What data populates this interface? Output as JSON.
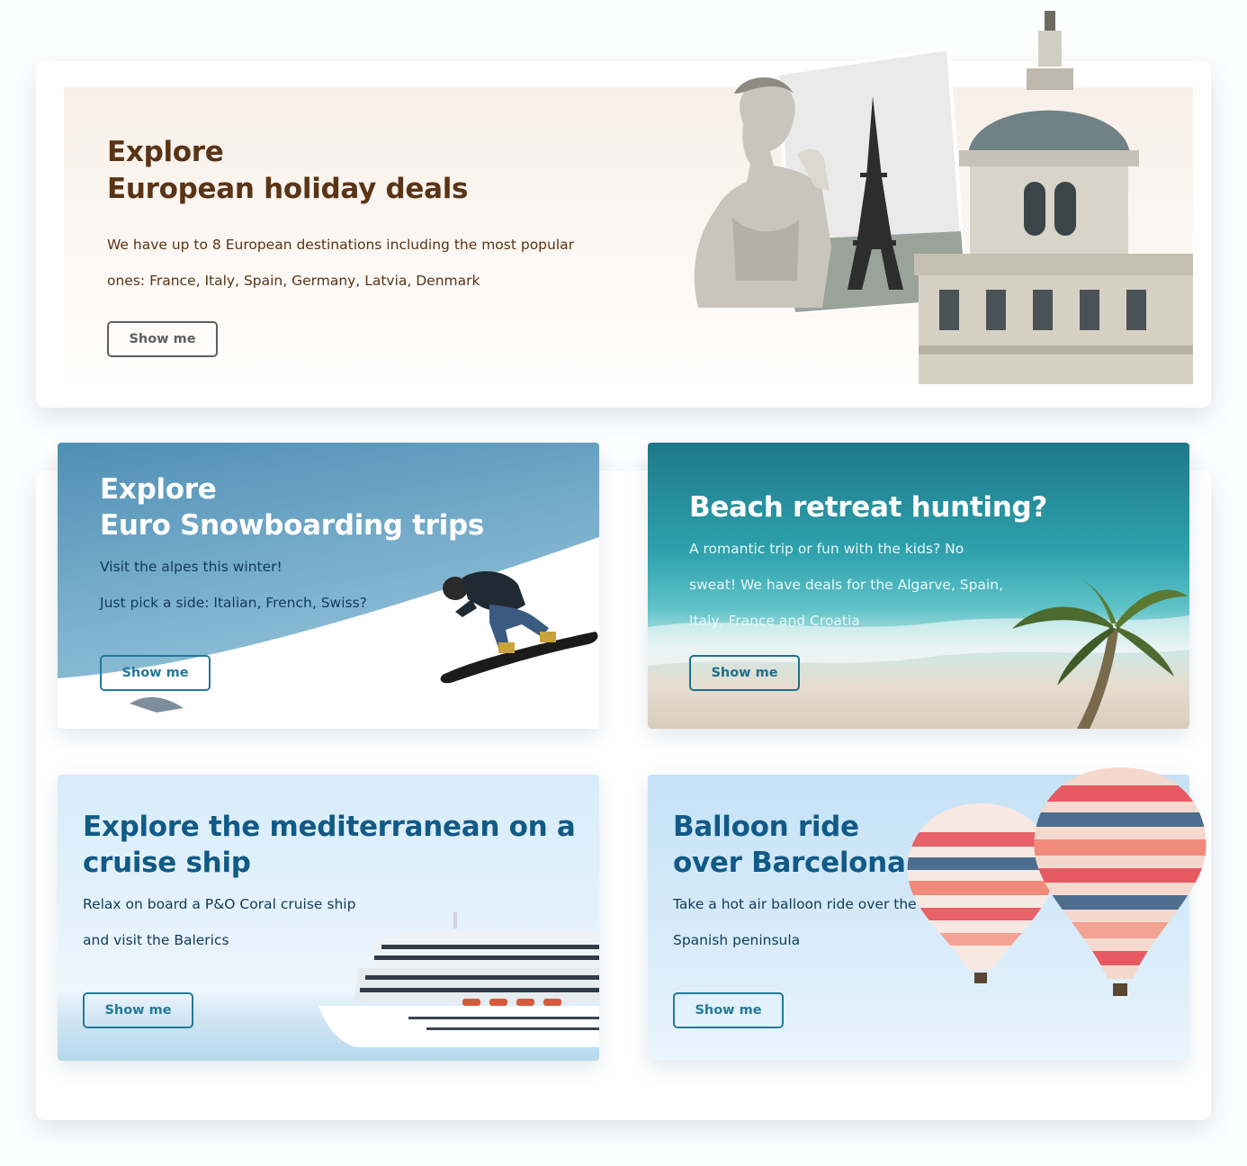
{
  "hero": {
    "title_line1": "Explore",
    "title_line2": "European holiday deals",
    "description": "We have up to 8 European destinations including the most popular ones: France, Italy, Spain, Germany, Latvia, Denmark",
    "button_label": "Show me",
    "images": [
      "david-statue",
      "eiffel-tower-photo",
      "domed-building"
    ]
  },
  "cards": [
    {
      "title_line1": "Explore",
      "title_line2": "Euro Snowboarding trips",
      "desc_line1": "Visit the alpes this winter!",
      "desc_line2": "Just pick a side: Italian, French, Swiss?",
      "button_label": "Show me",
      "image": "snowboarder"
    },
    {
      "title": "Beach retreat hunting?",
      "description": "A romantic trip or fun with the kids? No sweat! We have deals for the Algarve, Spain, Italy, France and Croatia",
      "button_label": "Show me",
      "image": "palm-tree-beach"
    },
    {
      "title": "Explore the mediterranean on a cruise ship",
      "desc_line1": "Relax on board a P&O Coral cruise ship",
      "desc_line2": "and visit the Balerics",
      "button_label": "Show me",
      "image": "cruise-ship"
    },
    {
      "title_line1": "Balloon ride",
      "title_line2": "over Barcelona",
      "desc_line1": "Take a hot air balloon ride over the",
      "desc_line2": "Spanish peninsula",
      "button_label": "Show me",
      "image": "hot-air-balloons"
    }
  ],
  "colors": {
    "hero_text": "#5a3416",
    "card_title": "#115a87",
    "button_accent": "#24799b"
  }
}
